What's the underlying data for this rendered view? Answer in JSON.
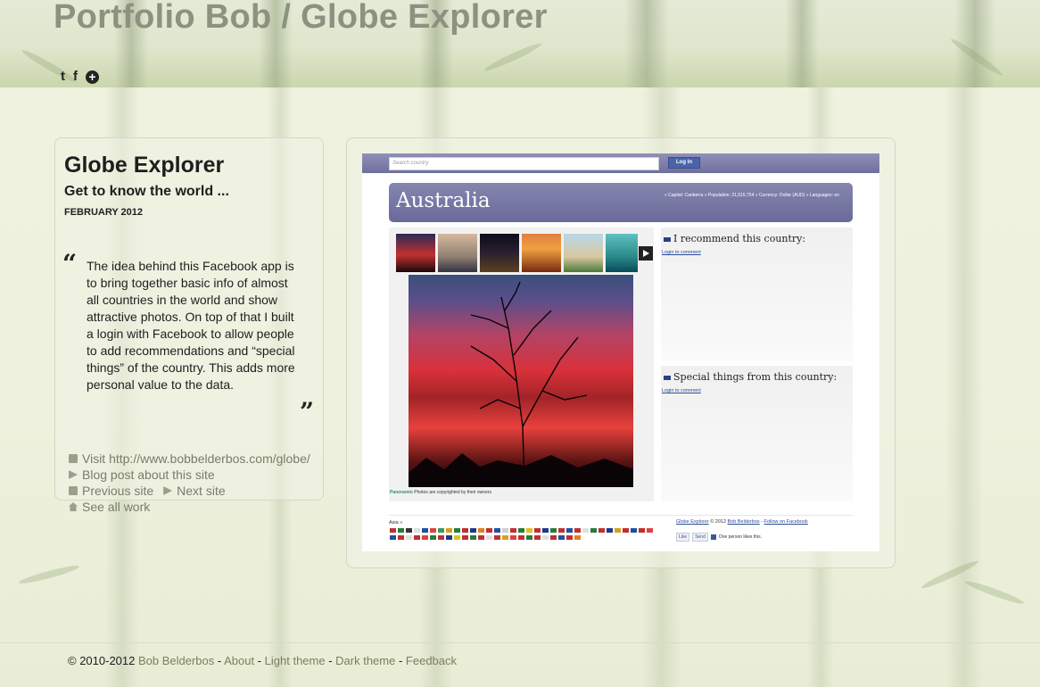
{
  "header": {
    "site_title": "Portfolio Bob / Globe Explorer",
    "social": [
      {
        "name": "twitter-icon",
        "glyph": "t"
      },
      {
        "name": "facebook-icon",
        "glyph": "f"
      },
      {
        "name": "plus-icon",
        "glyph": "+"
      }
    ]
  },
  "project": {
    "title": "Globe Explorer",
    "subtitle": "Get to know the world ...",
    "date": "FEBRUARY 2012",
    "quote_open": "“",
    "quote_close": "”",
    "description": "The idea behind this Facebook app is to bring together basic info of almost all countries in the world and show attractive photos. On top of that I built a login with Facebook to allow people to add recommendations and “special things” of the country. This adds more personal value to the data.",
    "links": {
      "visit": "Visit http://www.bobbelderbos.com/globe/",
      "blog": "Blog post about this site",
      "previous": "Previous site",
      "next": "Next site",
      "all": "See all work"
    }
  },
  "app": {
    "search_placeholder": "Search country",
    "login_label": "Log In",
    "country": "Australia",
    "facts": "» Capital: Canberra » Population: 21,515,754 » Currency: Dollar (AUD) » Languages: en",
    "recommend_title": "I recommend this country:",
    "special_title": "Special things from this country:",
    "login_to_comment": "Login to comment",
    "photo_credit_brand": "Panoramio",
    "photo_credit_text": "Photos are copyrighted by their owners",
    "region_label": "Asia »",
    "footer_app": "Globe Explorer",
    "footer_copy": "© 2012",
    "footer_author": "Bob Belderbos",
    "footer_sep": "-",
    "footer_follow": "Follow on Facebook",
    "like_label": "Like",
    "send_label": "Send",
    "likes_text": "One person likes this."
  },
  "footer": {
    "copyright": "© 2010-2012",
    "author": "Bob Belderbos",
    "sep": " - ",
    "about": "About",
    "light": "Light theme",
    "dark": "Dark theme",
    "feedback": "Feedback"
  },
  "colors": {
    "background": "#eef1dd",
    "link": "#7a7f5f",
    "app_header": "#6f6f9e"
  }
}
